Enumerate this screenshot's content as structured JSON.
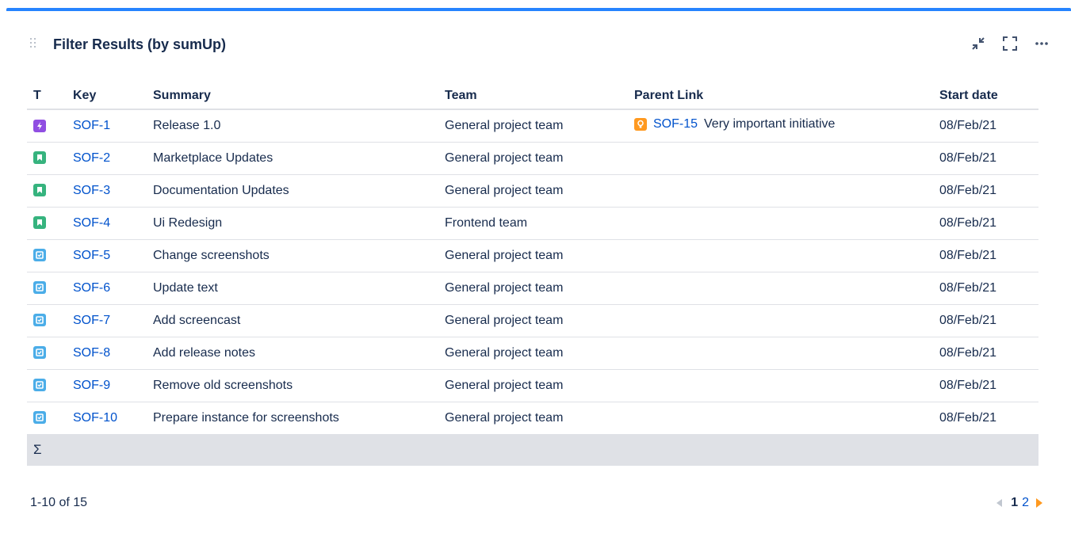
{
  "gadget": {
    "title": "Filter Results (by sumUp)"
  },
  "columns": {
    "type": "T",
    "key": "Key",
    "summary": "Summary",
    "team": "Team",
    "parent": "Parent Link",
    "start": "Start date"
  },
  "rows": [
    {
      "type": "epic-icon",
      "key": "SOF-1",
      "summary": "Release 1.0",
      "team": "General project team",
      "parent_key": "SOF-15",
      "parent_summary": "Very important initiative",
      "start": "08/Feb/21"
    },
    {
      "type": "story-icon",
      "key": "SOF-2",
      "summary": "Marketplace Updates",
      "team": "General project team",
      "start": "08/Feb/21"
    },
    {
      "type": "story-icon",
      "key": "SOF-3",
      "summary": "Documentation Updates",
      "team": "General project team",
      "start": "08/Feb/21"
    },
    {
      "type": "story-icon",
      "key": "SOF-4",
      "summary": "Ui Redesign",
      "team": "Frontend team",
      "start": "08/Feb/21"
    },
    {
      "type": "task-icon",
      "key": "SOF-5",
      "summary": "Change screenshots",
      "team": "General project team",
      "start": "08/Feb/21"
    },
    {
      "type": "task-icon",
      "key": "SOF-6",
      "summary": "Update text",
      "team": "General project team",
      "start": "08/Feb/21"
    },
    {
      "type": "task-icon",
      "key": "SOF-7",
      "summary": "Add screencast",
      "team": "General project team",
      "start": "08/Feb/21"
    },
    {
      "type": "task-icon",
      "key": "SOF-8",
      "summary": "Add release notes",
      "team": "General project team",
      "start": "08/Feb/21"
    },
    {
      "type": "task-icon",
      "key": "SOF-9",
      "summary": "Remove old screenshots",
      "team": "General project team",
      "start": "08/Feb/21"
    },
    {
      "type": "task-icon",
      "key": "SOF-10",
      "summary": "Prepare instance for screenshots",
      "team": "General project team",
      "start": "08/Feb/21"
    }
  ],
  "sum_row": {
    "symbol": "Σ"
  },
  "footer": {
    "count": "1-10 of 15",
    "current_page": "1",
    "next_page": "2"
  },
  "colors": {
    "accent": "#2684ff",
    "link": "#0052cc",
    "epic": "#904ee2",
    "story": "#36b37e",
    "task": "#4bade8",
    "initiative": "#ff991f"
  }
}
